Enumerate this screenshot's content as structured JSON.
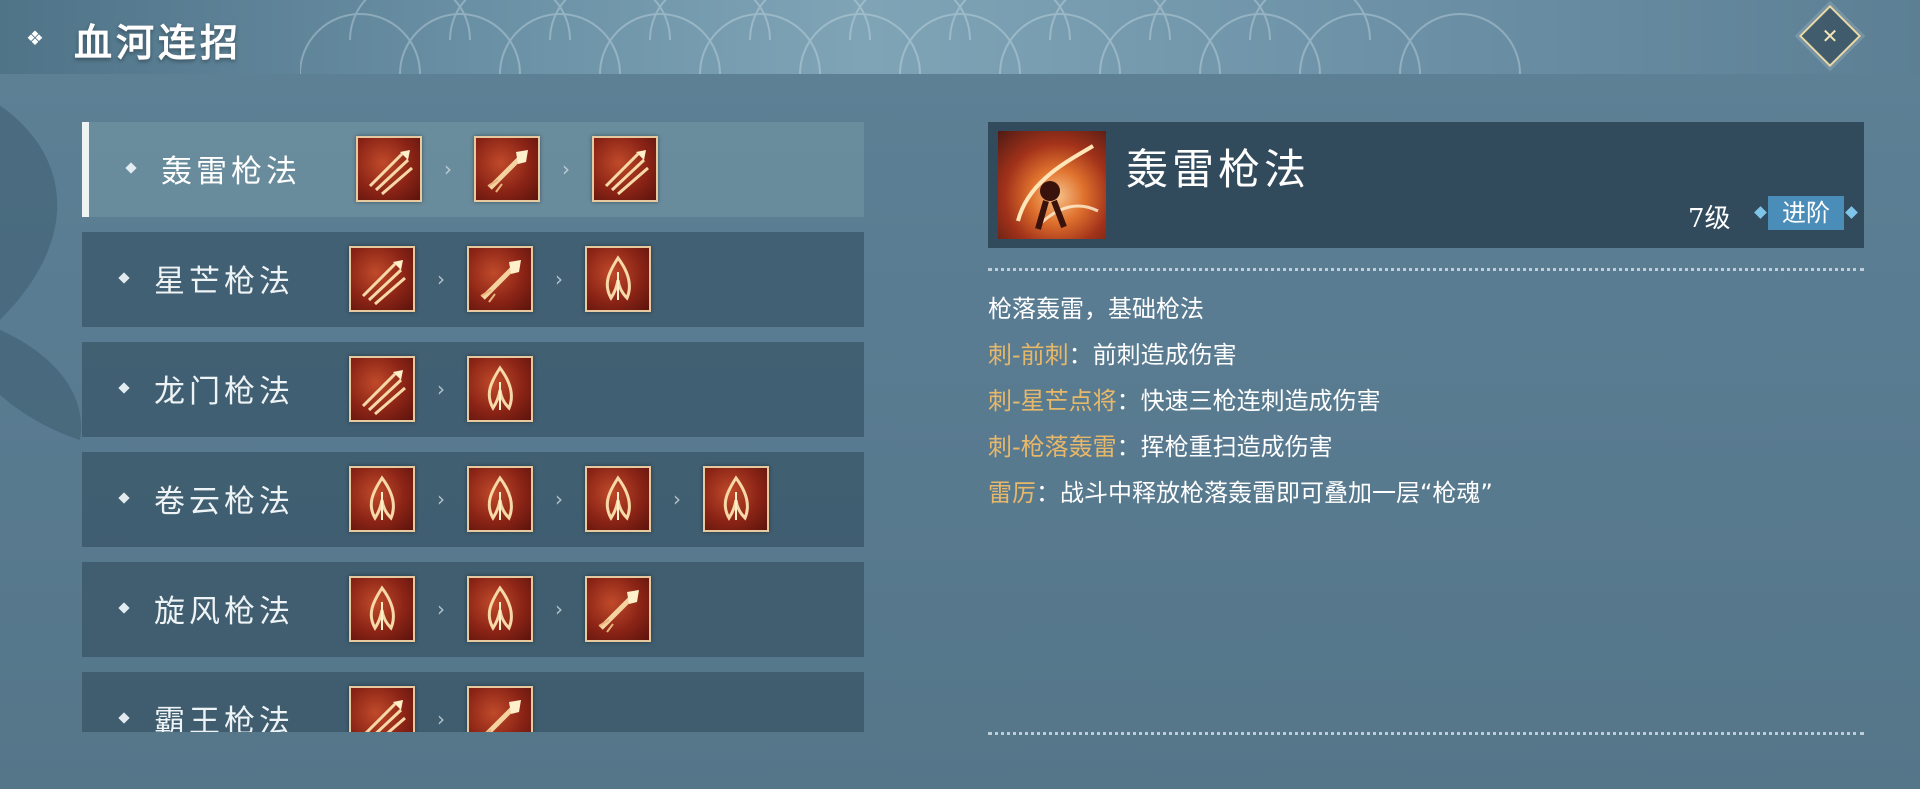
{
  "header": {
    "title": "血河连招"
  },
  "colors": {
    "accent_gold": "#e8b86a",
    "advance_blue": "#4a8db8",
    "panel_dark": "#233a4a"
  },
  "combos": [
    {
      "name": "轰雷枪法",
      "selected": true,
      "skills": [
        "slash",
        "thrust",
        "slash"
      ]
    },
    {
      "name": "星芒枪法",
      "selected": false,
      "skills": [
        "slash",
        "thrust",
        "flame"
      ]
    },
    {
      "name": "龙门枪法",
      "selected": false,
      "skills": [
        "slash",
        "flame"
      ]
    },
    {
      "name": "卷云枪法",
      "selected": false,
      "skills": [
        "flame",
        "flame",
        "flame",
        "flame"
      ]
    },
    {
      "name": "旋风枪法",
      "selected": false,
      "skills": [
        "flame",
        "flame",
        "thrust"
      ]
    },
    {
      "name": "霸王枪法",
      "selected": false,
      "skills": [
        "slash",
        "thrust"
      ]
    }
  ],
  "detail": {
    "name": "轰雷枪法",
    "level": "7级",
    "advance_label": "进阶",
    "summary": "枪落轰雷，基础枪法",
    "lines": [
      {
        "key": "刺-前刺",
        "sep": "：",
        "text": "前刺造成伤害"
      },
      {
        "key": "刺-星芒点将",
        "sep": "：",
        "text": "快速三枪连刺造成伤害"
      },
      {
        "key": "刺-枪落轰雷",
        "sep": "：",
        "text": "挥枪重扫造成伤害"
      },
      {
        "key": "雷厉",
        "sep": "：",
        "text": "战斗中释放枪落轰雷即可叠加一层“枪魂”"
      }
    ]
  }
}
